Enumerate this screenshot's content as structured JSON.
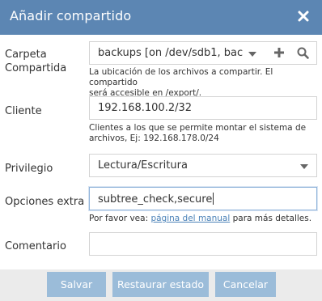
{
  "dialog": {
    "title": "Añadir compartido",
    "close_icon": "close-icon"
  },
  "form": {
    "shared_folder": {
      "label_line1": "Carpeta",
      "label_line2": "Compartida",
      "value": "backups [on /dev/sdb1, bac",
      "help_line1": "La ubicación de los archivos a compartir. El compartido",
      "help_line2": "será accesible en /export/."
    },
    "client": {
      "label": "Cliente",
      "value": "192.168.100.2/32",
      "help_line1": "Clientes a los que se permite montar el sistema de",
      "help_line2": "archivos, Ej: 192.168.178.0/24"
    },
    "privilege": {
      "label": "Privilegio",
      "value": "Lectura/Escritura"
    },
    "extra_options": {
      "label": "Opciones extra",
      "value": "subtree_check,secure",
      "help_prefix": "Por favor vea: ",
      "help_link": "página del manual",
      "help_suffix": " para más detalles."
    },
    "comment": {
      "label": "Comentario",
      "value": ""
    }
  },
  "buttons": {
    "save": "Salvar",
    "reset": "Restaurar estado",
    "cancel": "Cancelar"
  },
  "colors": {
    "titlebar": "#5c86b3",
    "button": "#9bbcd9",
    "link": "#4b82b8",
    "footer": "#ebebeb"
  }
}
